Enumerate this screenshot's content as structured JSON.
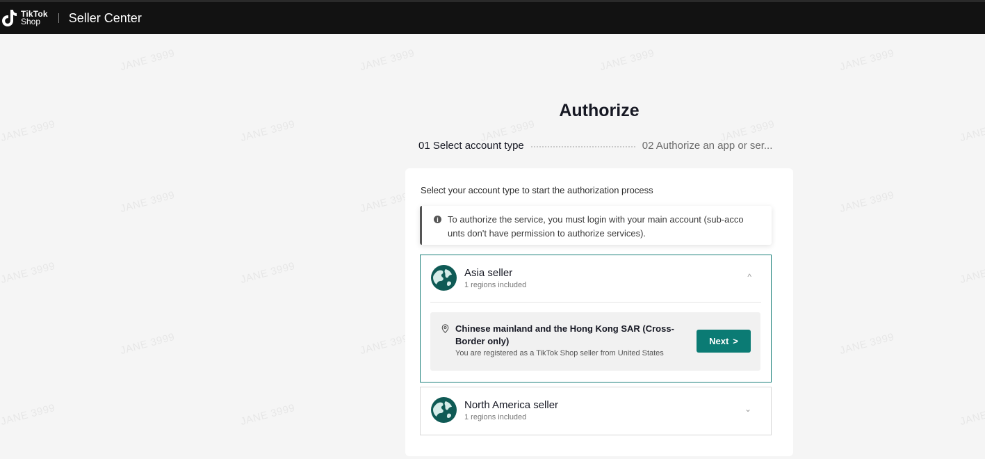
{
  "header": {
    "logo_line1": "TikTok",
    "logo_line2": "Shop",
    "title": "Seller Center"
  },
  "watermark_text": "JANE 3999",
  "page": {
    "title": "Authorize",
    "step1": "01  Select account type",
    "step2": "02  Authorize an app or ser..."
  },
  "card": {
    "intro": "Select your account type to start the authorization process",
    "notice_line1": "To authorize the service, you must login with your main account (sub-acco",
    "notice_line2": "unts don't have permission to authorize services).",
    "regions": [
      {
        "name": "Asia seller",
        "sub": "1 regions included",
        "chevron": "^",
        "item": {
          "title": "Chinese mainland and the Hong Kong SAR (Cross-Border only)",
          "desc": "You are registered as a TikTok Shop seller from United States",
          "button": "Next",
          "button_icon": ">"
        }
      },
      {
        "name": "North America seller",
        "sub": "1 regions included",
        "chevron": "⌄"
      }
    ]
  },
  "colors": {
    "accent": "#0b7b74",
    "topbar": "#121212",
    "page_bg": "#f5f5f5"
  }
}
